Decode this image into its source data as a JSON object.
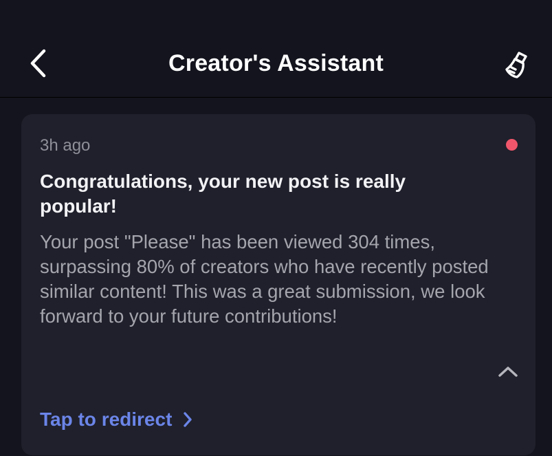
{
  "header": {
    "title": "Creator's Assistant",
    "back_icon": "chevron-left-icon",
    "clear_icon": "broom-icon"
  },
  "notification": {
    "time": "3h ago",
    "unread": true,
    "title": "Congratulations, your new post is really popular!",
    "body": "Your post \"Please\" has been viewed 304 times, surpassing 80% of creators who have recently posted similar content! This was a great submission, we look forward to your future contributions!",
    "collapse_icon": "chevron-up-icon",
    "link_label": "Tap to redirect"
  },
  "colors": {
    "background": "#13141d",
    "card": "#1f202b",
    "title_text": "#ffffff",
    "body_text": "#a4a5ad",
    "muted_text": "#8e8f98",
    "link": "#6b85e8",
    "unread_dot": "#f0566b"
  }
}
